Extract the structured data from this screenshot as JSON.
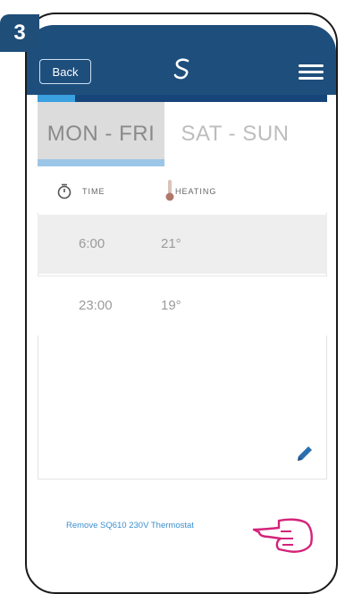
{
  "step": {
    "number": "3"
  },
  "header": {
    "back_label": "Back",
    "logo_icon": "swirl-logo-icon",
    "menu_icon": "hamburger-menu-icon",
    "bg_color": "#1e4e7c"
  },
  "tabs": [
    {
      "label": "MON - FRI",
      "active": true
    },
    {
      "label": "SAT - SUN",
      "active": false
    }
  ],
  "columns": {
    "time_label": "TIME",
    "heating_label": "HEATING"
  },
  "schedule": [
    {
      "time": "6:00",
      "temp": "21°"
    },
    {
      "time": "23:00",
      "temp": "19°"
    }
  ],
  "footer": {
    "remove_link": "Remove SQ610 230V Thermostat"
  }
}
